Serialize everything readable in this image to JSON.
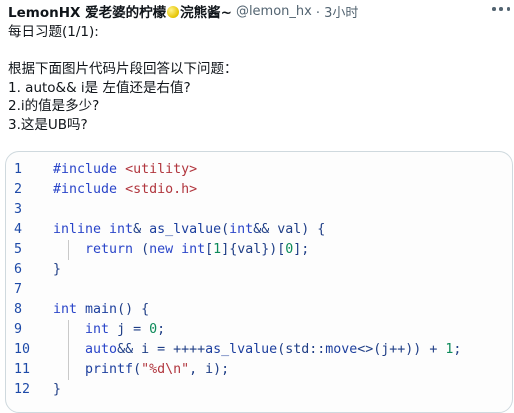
{
  "post": {
    "author_name": "LemonHX 爱老婆的柠檬",
    "author_suffix": "浣熊酱~",
    "handle": "@lemon_hx",
    "time": "· 3小时",
    "lines": [
      "每日习题(1/1):",
      "",
      "根据下面图片代码片段回答以下问题：",
      "1. auto&& i是 左值还是右值?",
      "2.i的值是多少?",
      "3.这是UB吗?"
    ]
  },
  "code": {
    "line_numbers": [
      "1",
      "2",
      "3",
      "4",
      "5",
      "6",
      "7",
      "8",
      "9",
      "10",
      "11",
      "12"
    ],
    "lines": [
      [
        {
          "t": "#include ",
          "c": "kw"
        },
        {
          "t": "<utility>",
          "c": "inc"
        }
      ],
      [
        {
          "t": "#include ",
          "c": "kw"
        },
        {
          "t": "<stdio.h>",
          "c": "inc"
        }
      ],
      [],
      [
        {
          "t": "inline ",
          "c": "kw"
        },
        {
          "t": "int",
          "c": "kw"
        },
        {
          "t": "& ",
          "c": "plain"
        },
        {
          "t": "as_lvalue",
          "c": "fn"
        },
        {
          "t": "(",
          "c": "plain"
        },
        {
          "t": "int",
          "c": "kw"
        },
        {
          "t": "&& val) {",
          "c": "plain"
        }
      ],
      [
        {
          "t": "    ",
          "c": "plain"
        },
        {
          "t": "return ",
          "c": "kw"
        },
        {
          "t": "(",
          "c": "plain"
        },
        {
          "t": "new ",
          "c": "kw"
        },
        {
          "t": "int",
          "c": "kw"
        },
        {
          "t": "[",
          "c": "plain"
        },
        {
          "t": "1",
          "c": "num"
        },
        {
          "t": "]{val})[",
          "c": "plain"
        },
        {
          "t": "0",
          "c": "num"
        },
        {
          "t": "];",
          "c": "plain"
        }
      ],
      [
        {
          "t": "}",
          "c": "plain"
        }
      ],
      [],
      [
        {
          "t": "int ",
          "c": "kw"
        },
        {
          "t": "main",
          "c": "fn"
        },
        {
          "t": "() {",
          "c": "plain"
        }
      ],
      [
        {
          "t": "    ",
          "c": "plain"
        },
        {
          "t": "int ",
          "c": "kw"
        },
        {
          "t": "j = ",
          "c": "plain"
        },
        {
          "t": "0",
          "c": "num"
        },
        {
          "t": ";",
          "c": "plain"
        }
      ],
      [
        {
          "t": "    ",
          "c": "plain"
        },
        {
          "t": "auto",
          "c": "kw"
        },
        {
          "t": "&& i = ++++",
          "c": "plain"
        },
        {
          "t": "as_lvalue",
          "c": "fn"
        },
        {
          "t": "(std::",
          "c": "plain"
        },
        {
          "t": "move",
          "c": "fn"
        },
        {
          "t": "<>(j++)) + ",
          "c": "plain"
        },
        {
          "t": "1",
          "c": "num"
        },
        {
          "t": ";",
          "c": "plain"
        }
      ],
      [
        {
          "t": "    ",
          "c": "plain"
        },
        {
          "t": "printf",
          "c": "fn"
        },
        {
          "t": "(",
          "c": "plain"
        },
        {
          "t": "\"%d\\n\"",
          "c": "str"
        },
        {
          "t": ", i);",
          "c": "plain"
        }
      ],
      [
        {
          "t": "}",
          "c": "plain"
        }
      ]
    ]
  },
  "colors": {
    "keyword": "#2a45c9",
    "include_path": "#b1363e",
    "number": "#0c8a59",
    "string": "#b1363e",
    "line_number": "#1e4aa8"
  },
  "icons": {
    "more": "more-horizontal-icon",
    "emoji": "lemon-emoji-icon"
  }
}
